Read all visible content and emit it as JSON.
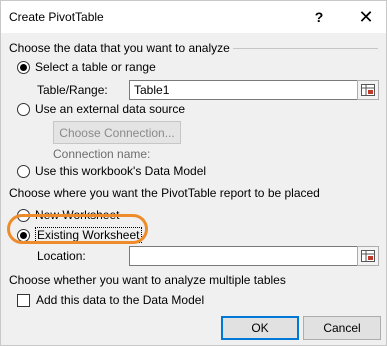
{
  "window": {
    "title": "Create PivotTable",
    "help_label": "?",
    "close_label": "✕"
  },
  "section_data": {
    "label": "Choose the data that you want to analyze",
    "select_table_label": "Select a table or range",
    "select_table_checked": true,
    "table_range_label": "Table/Range:",
    "table_range_value": "Table1",
    "external_source_label": "Use an external data source",
    "choose_connection_label": "Choose Connection...",
    "connection_name_label": "Connection name:",
    "data_model_label": "Use this workbook's Data Model"
  },
  "section_location": {
    "label": "Choose where you want the PivotTable report to be placed",
    "new_worksheet_label": "New Worksheet",
    "existing_worksheet_label": "Existing Worksheet",
    "existing_worksheet_checked": true,
    "location_label": "Location:",
    "location_value": ""
  },
  "section_multiple": {
    "label": "Choose whether you want to analyze multiple tables",
    "add_to_model_label": "Add this data to the Data Model",
    "add_to_model_checked": false
  },
  "buttons": {
    "ok_label": "OK",
    "cancel_label": "Cancel"
  },
  "colors": {
    "highlight_ring": "#ee8c2c",
    "dialog_background": "#f0f0f0",
    "default_button_border": "#0078d7"
  },
  "icons": {
    "range_selector": "range-selector-icon"
  }
}
